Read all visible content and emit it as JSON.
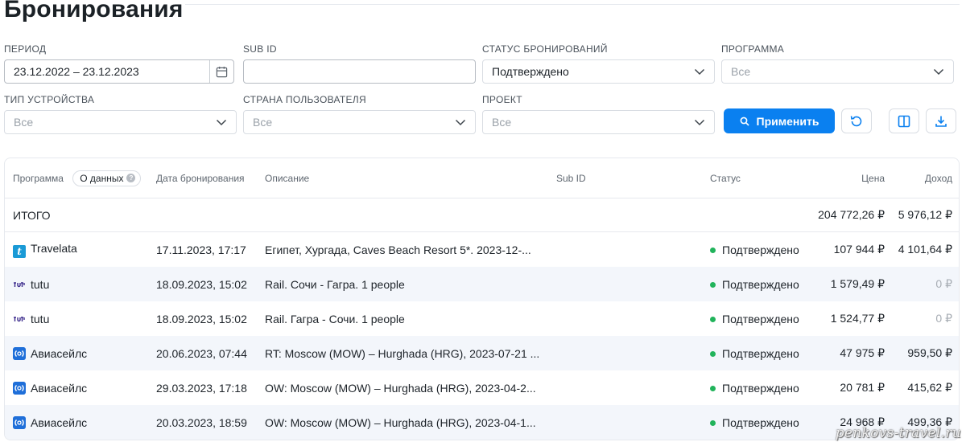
{
  "page": {
    "title": "Бронирования"
  },
  "filters": {
    "period": {
      "label": "Период",
      "value": "23.12.2022 – 23.12.2023"
    },
    "sub_id": {
      "label": "Sub ID",
      "value": ""
    },
    "status": {
      "label": "Статус бронирований",
      "value": "Подтверждено"
    },
    "program": {
      "label": "Программа",
      "value": "Все"
    },
    "device": {
      "label": "Тип устройства",
      "value": "Все"
    },
    "country": {
      "label": "Страна пользователя",
      "value": "Все"
    },
    "project": {
      "label": "Проект",
      "value": "Все"
    }
  },
  "actions": {
    "apply_label": "Применить"
  },
  "table": {
    "columns": {
      "program": "Программа",
      "about": "О данных",
      "date": "Дата бронирования",
      "description": "Описание",
      "sub_id": "Sub ID",
      "status": "Статус",
      "price": "Цена",
      "income": "Доход"
    },
    "total": {
      "label": "ИТОГО",
      "price": "204 772,26 ₽",
      "income": "5 976,12 ₽"
    },
    "rows": [
      {
        "program": "Travelata",
        "logo": "travelata-logo",
        "date": "17.11.2023, 17:17",
        "description": "Египет, Хургада, Caves Beach Resort 5*. 2023-12-...",
        "status": "Подтверждено",
        "price": "107 944 ₽",
        "income": "4 101,64 ₽"
      },
      {
        "program": "tutu",
        "logo": "tutu-logo",
        "date": "18.09.2023, 15:02",
        "description": "Rail. Сочи - Гагра. 1 people",
        "status": "Подтверждено",
        "price": "1 579,49 ₽",
        "income": "0 ₽"
      },
      {
        "program": "tutu",
        "logo": "tutu-logo",
        "date": "18.09.2023, 15:02",
        "description": "Rail. Гагра - Сочи. 1 people",
        "status": "Подтверждено",
        "price": "1 524,77 ₽",
        "income": "0 ₽"
      },
      {
        "program": "Авиасейлс",
        "logo": "aviasales-logo",
        "date": "20.06.2023, 07:44",
        "description": "RT: Moscow (MOW) – Hurghada (HRG), 2023-07-21 ...",
        "status": "Подтверждено",
        "price": "47 975 ₽",
        "income": "959,50 ₽"
      },
      {
        "program": "Авиасейлс",
        "logo": "aviasales-logo",
        "date": "29.03.2023, 17:18",
        "description": "OW: Moscow (MOW) – Hurghada (HRG), 2023-04-2...",
        "status": "Подтверждено",
        "price": "20 781 ₽",
        "income": "415,62 ₽"
      },
      {
        "program": "Авиасейлс",
        "logo": "aviasales-logo",
        "date": "20.03.2023, 18:59",
        "description": "OW: Moscow (MOW) – Hurghada (HRG), 2023-04-1...",
        "status": "Подтверждено",
        "price": "24 968 ₽",
        "income": "499,36 ₽"
      }
    ]
  },
  "colors": {
    "accent": "#0a80f0",
    "status_ok": "#21b35b",
    "row_alt": "#f3f6fb"
  },
  "watermark": "penkovs-travel.ru"
}
